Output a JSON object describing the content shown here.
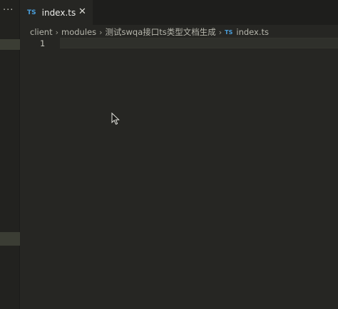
{
  "sidebar": {
    "more_label": "···"
  },
  "tab": {
    "badge": "TS",
    "label": "index.ts",
    "close": "✕"
  },
  "breadcrumb": {
    "items": [
      "client",
      "modules",
      "测试swqa接口ts类型文档生成"
    ],
    "file_badge": "TS",
    "file": "index.ts",
    "separator": "›"
  },
  "editor": {
    "line_number": "1"
  },
  "colors": {
    "accent_ts": "#4a9fdc",
    "editor_bg": "#262623",
    "tabbar_bg": "#1e1e1c"
  }
}
